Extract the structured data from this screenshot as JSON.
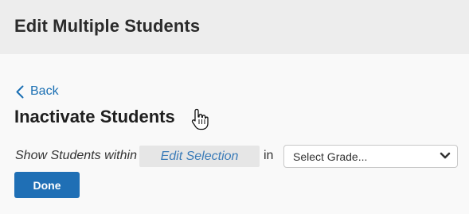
{
  "header": {
    "title": "Edit Multiple Students"
  },
  "nav": {
    "back_label": "Back",
    "back_icon": "chevron-left-icon"
  },
  "page": {
    "title": "Inactivate Students"
  },
  "filter": {
    "show_label": "Show Students within",
    "edit_selection_label": "Edit Selection",
    "in_label": "in",
    "grade_select_placeholder": "Select Grade...",
    "grade_select_icon": "chevron-down-icon"
  },
  "actions": {
    "done_label": "Done"
  },
  "colors": {
    "accent": "#1f6fb5",
    "link": "#1a6fb3",
    "header_bg": "#ededed",
    "page_bg": "#f9f9f9"
  },
  "cursor": {
    "icon": "hand-pointer-icon"
  }
}
